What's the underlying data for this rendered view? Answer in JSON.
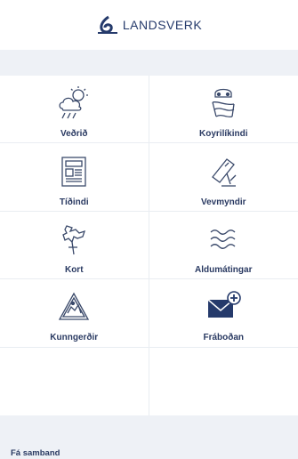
{
  "header": {
    "logo_text": "LANDSVERK"
  },
  "tiles": [
    {
      "label": "Veðrið",
      "icon": "weather-icon"
    },
    {
      "label": "Koyrilíkindi",
      "icon": "driving-conditions-icon"
    },
    {
      "label": "Tíðindi",
      "icon": "news-icon"
    },
    {
      "label": "Vevmyndir",
      "icon": "webcam-icon"
    },
    {
      "label": "Kort",
      "icon": "map-icon"
    },
    {
      "label": "Aldumátingar",
      "icon": "wave-icon"
    },
    {
      "label": "Kunngerðir",
      "icon": "announcement-icon"
    },
    {
      "label": "Fráboðan",
      "icon": "report-mail-icon"
    }
  ],
  "footer": {
    "contact_label": "Fá samband"
  },
  "colors": {
    "brand_blue": "#253a6b",
    "band": "#eef1f6"
  }
}
